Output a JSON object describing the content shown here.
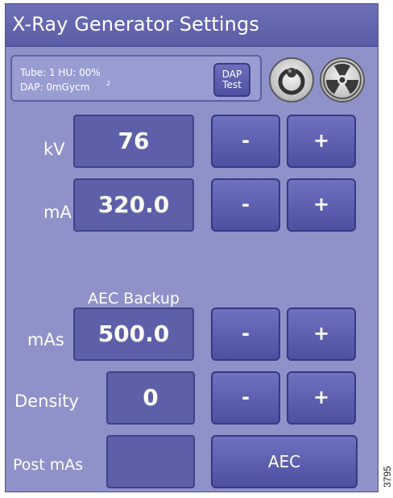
{
  "window": {
    "title": "X-Ray Generator Settings"
  },
  "info": {
    "tube_line": "Tube: 1  HU: 00%",
    "dap_line": "DAP: 0mGycm",
    "dap_sup": "2",
    "dap_test_line1": "DAP",
    "dap_test_line2": "Test"
  },
  "status_icons": [
    "exposure-switch-icon",
    "radiation-icon"
  ],
  "controls": {
    "kv": {
      "label": "kV",
      "value": "76",
      "minus": "-",
      "plus": "+"
    },
    "ma": {
      "label": "mA",
      "value": "320.0",
      "minus": "-",
      "plus": "+"
    },
    "aec_backup": {
      "title": "AEC Backup"
    },
    "mas": {
      "label": "mAs",
      "value": "500.0",
      "minus": "-",
      "plus": "+"
    },
    "density": {
      "label": "Density",
      "value": "0",
      "minus": "-",
      "plus": "+"
    },
    "post_mas": {
      "label": "Post mAs",
      "value": ""
    },
    "aec": {
      "label": "AEC"
    }
  },
  "figure_number": "3795",
  "colors": {
    "panel_bg": "#8f92c9",
    "title_bg": "#5f62aa",
    "button": "#5b5eae",
    "value_box": "#5d60a8",
    "text": "#ffffff"
  }
}
